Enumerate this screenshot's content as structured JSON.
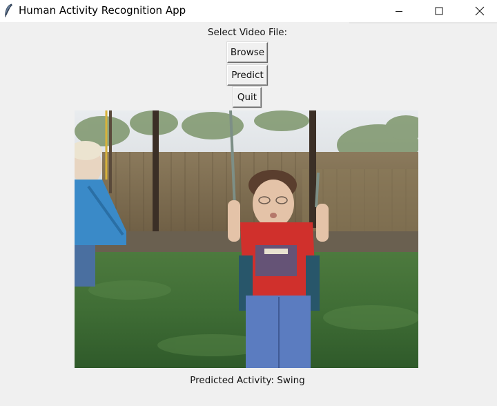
{
  "window": {
    "title": "Human Activity Recognition App",
    "icon": "feather-icon",
    "controls": {
      "minimize": "minimize-icon",
      "maximize": "maximize-icon",
      "close": "close-icon"
    }
  },
  "main": {
    "select_label": "Select Video File:",
    "browse_label": "Browse",
    "predict_label": "Predict",
    "quit_label": "Quit",
    "prediction_text": "Predicted Activity: Swing"
  },
  "video": {
    "subject": "children-on-swings-frame"
  }
}
